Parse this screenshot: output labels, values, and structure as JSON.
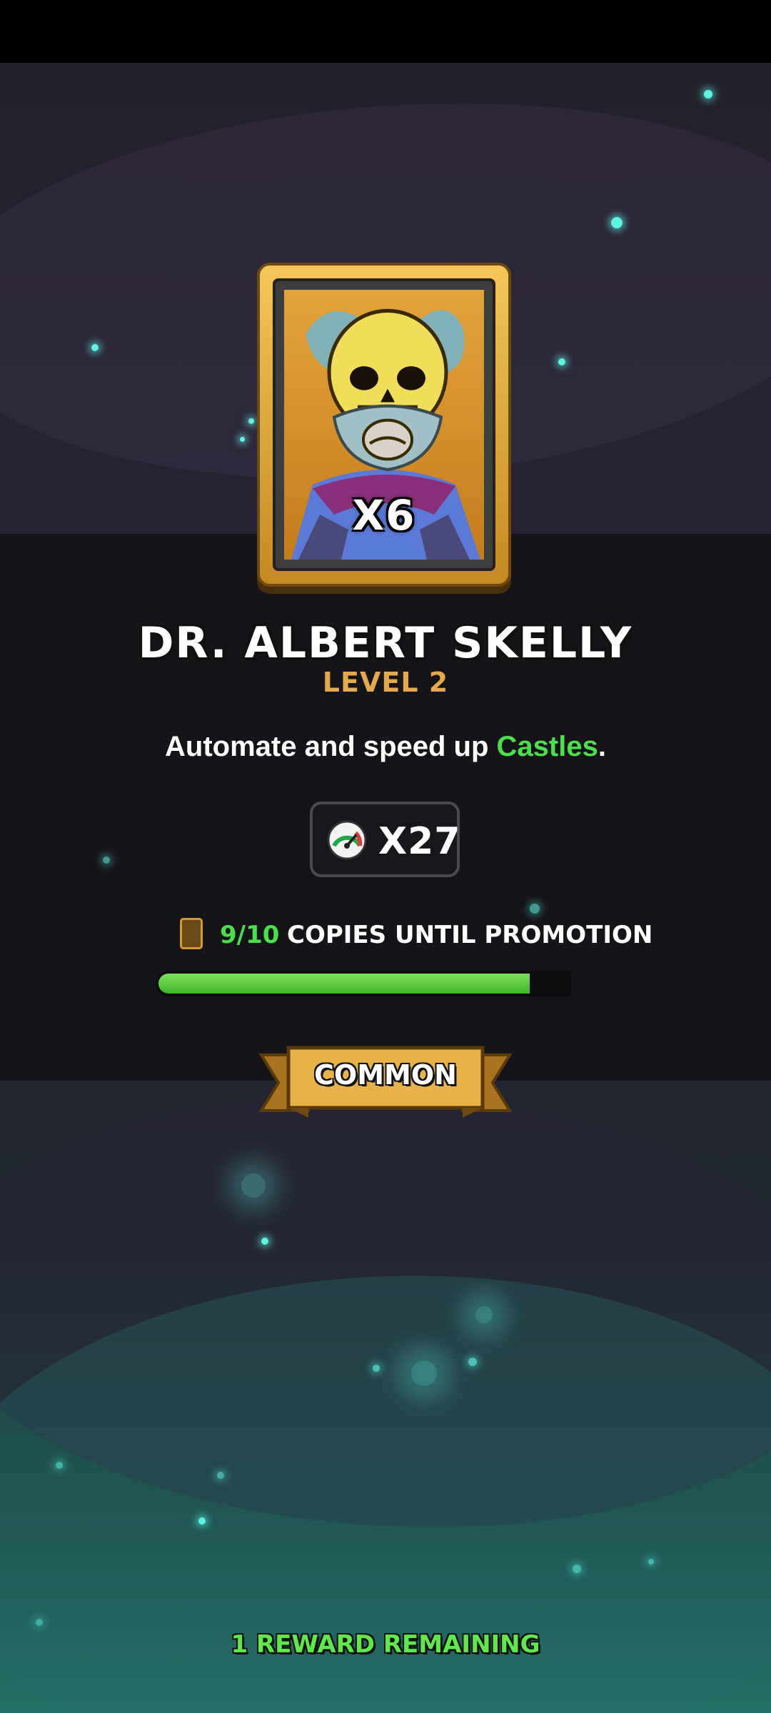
{
  "card": {
    "count_label": "X6",
    "portrait_icon": "skeleton-scientist-portrait"
  },
  "hero": {
    "name": "DR. ALBERT SKELLY",
    "level": "LEVEL 2"
  },
  "description": {
    "text_before": "Automate and speed up ",
    "highlight": "Castles",
    "text_after": "."
  },
  "multiplier": {
    "icon": "speedometer-icon",
    "label": "X27"
  },
  "promotion": {
    "icon": "card-copy-icon",
    "count": "9/10",
    "label": "COPIES UNTIL PROMOTION",
    "progress_fraction": 0.9
  },
  "rarity": {
    "label": "COMMON"
  },
  "footer": {
    "rewards_remaining": "1 REWARD REMAINING"
  },
  "colors": {
    "accent_green": "#49e04a",
    "level_gold": "#e5a949",
    "particle_cyan": "#5ef2e3"
  }
}
